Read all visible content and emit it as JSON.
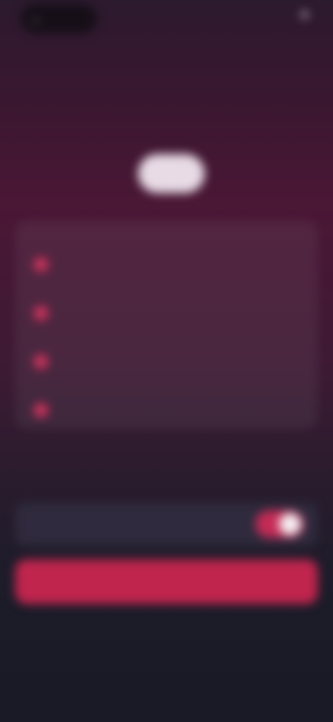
{
  "header": {
    "back_icon": "back-arrow-icon",
    "back_label": "",
    "right_label": "",
    "subtitle": ""
  },
  "hero": {
    "title": "",
    "subtitle": "",
    "price_label": "",
    "price_value": ""
  },
  "features": [
    {
      "icon": "check-icon",
      "text": ""
    },
    {
      "icon": "check-icon",
      "text": ""
    },
    {
      "icon": "check-icon",
      "text": ""
    },
    {
      "icon": "check-icon",
      "text": ""
    }
  ],
  "toggle": {
    "label": "",
    "state": "on"
  },
  "cta": {
    "label": ""
  },
  "secondary": {
    "label": ""
  },
  "footer": {
    "left": "",
    "right": ""
  },
  "colors": {
    "accent": "#c0254e",
    "background_top": "#3a1730",
    "background_bottom": "#191a25",
    "card": "#2f2a3d"
  }
}
